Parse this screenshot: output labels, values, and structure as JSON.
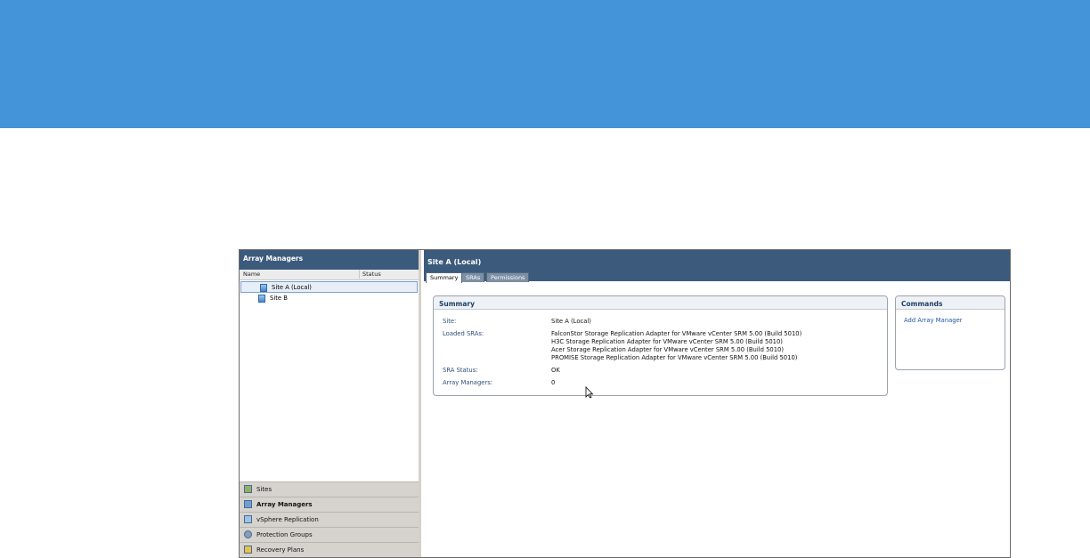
{
  "left_pane": {
    "title": "Array Managers",
    "columns": [
      "Name",
      "Status"
    ],
    "tree": [
      {
        "label": "Site A (Local)",
        "selected": true
      },
      {
        "label": "Site B",
        "selected": false
      }
    ],
    "nav": [
      {
        "label": "Sites",
        "icon": "sites-icon"
      },
      {
        "label": "Array Managers",
        "icon": "array-managers-icon",
        "active": true
      },
      {
        "label": "vSphere Replication",
        "icon": "vsphere-replication-icon"
      },
      {
        "label": "Protection Groups",
        "icon": "protection-groups-icon"
      },
      {
        "label": "Recovery Plans",
        "icon": "recovery-plans-icon"
      }
    ]
  },
  "right_pane": {
    "title": "Site A (Local)",
    "tabs": [
      "Summary",
      "SRAs",
      "Permissions"
    ],
    "summary": {
      "heading": "Summary",
      "site_label": "Site:",
      "site_value": "Site A (Local)",
      "loaded_sras_label": "Loaded SRAs:",
      "loaded_sras": [
        "FalconStor Storage Replication Adapter for VMware vCenter SRM 5.00 (Build 5010)",
        "H3C Storage Replication Adapter for VMware vCenter SRM 5.00 (Build 5010)",
        "Acer Storage Replication Adapter for VMware vCenter SRM 5.00 (Build 5010)",
        "PROMISE Storage Replication Adapter for VMware vCenter SRM 5.00 (Build 5010)"
      ],
      "sra_status_label": "SRA Status:",
      "sra_status_value": "OK",
      "array_managers_label": "Array Managers:",
      "array_managers_value": "0"
    },
    "commands": {
      "heading": "Commands",
      "add_array_manager": "Add Array Manager"
    }
  },
  "colors": {
    "banner": "#4394d9",
    "header": "#3c5a7c",
    "link": "#1f55a7"
  }
}
